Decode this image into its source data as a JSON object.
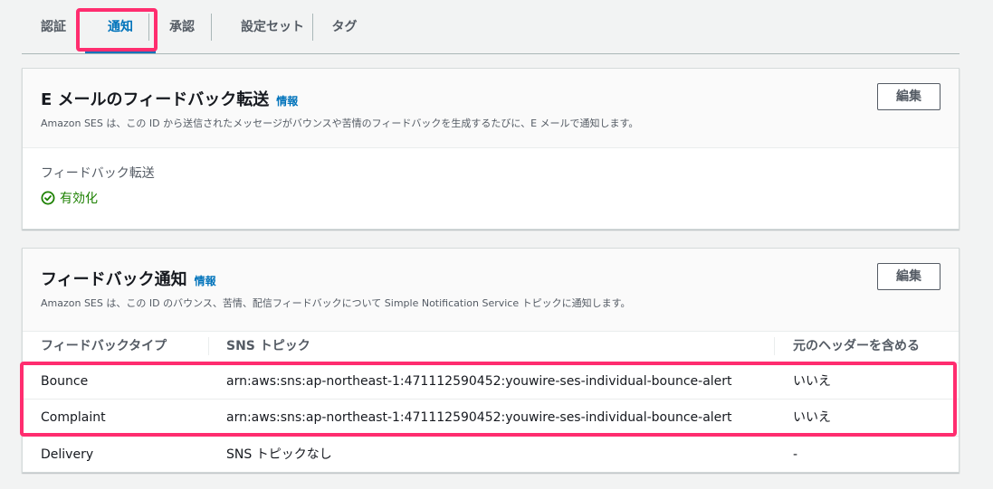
{
  "tabs": [
    "認証",
    "通知",
    "承認",
    "設定セット",
    "タグ"
  ],
  "active_tab": "通知",
  "accent_color": "#0073bb",
  "highlight_color": "#ff2d6f",
  "email_feedback": {
    "title": "E メールのフィードバック転送",
    "info": "情報",
    "description": "Amazon SES は、この ID から送信されたメッセージがバウンスや苦情のフィードバックを生成するたびに、E メールで通知します。",
    "edit_label": "編集",
    "field_label": "フィードバック転送",
    "status": "有効化",
    "status_icon": "check-circle-icon"
  },
  "feedback_notifications": {
    "title": "フィードバック通知",
    "info": "情報",
    "description": "Amazon SES は、この ID のバウンス、苦情、配信フィードバックについて Simple Notification Service トピックに通知します。",
    "edit_label": "編集",
    "columns": [
      "フィードバックタイプ",
      "SNS トピック",
      "元のヘッダーを含める"
    ],
    "rows": [
      {
        "type": "Bounce",
        "topic": "arn:aws:sns:ap-northeast-1:471112590452:youwire-ses-individual-bounce-alert",
        "headers": "いいえ"
      },
      {
        "type": "Complaint",
        "topic": "arn:aws:sns:ap-northeast-1:471112590452:youwire-ses-individual-bounce-alert",
        "headers": "いいえ"
      },
      {
        "type": "Delivery",
        "topic": "SNS トピックなし",
        "headers": "-"
      }
    ]
  }
}
